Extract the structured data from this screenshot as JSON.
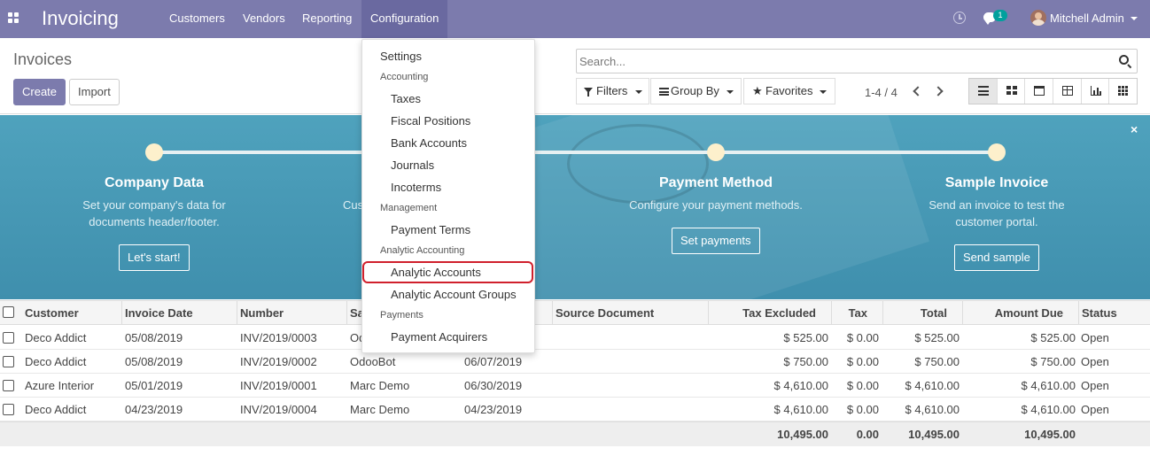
{
  "app": {
    "name": "Invoicing"
  },
  "navbar": {
    "menus": [
      "Customers",
      "Vendors",
      "Reporting",
      "Configuration"
    ],
    "active_menu": "Configuration",
    "message_count": "1",
    "user_name": "Mitchell Admin"
  },
  "control_panel": {
    "title": "Invoices",
    "create_label": "Create",
    "import_label": "Import",
    "search_placeholder": "Search...",
    "filters_label": "Filters",
    "groupby_label": "Group By",
    "favorites_label": "Favorites",
    "pager": "1-4 / 4"
  },
  "onboarding": {
    "close_glyph": "×",
    "steps": [
      {
        "title": "Company Data",
        "desc1": "Set your company's data for",
        "desc2": "documents header/footer.",
        "button": "Let's start!"
      },
      {
        "title": "",
        "desc1": "Cus",
        "desc2": "",
        "button": ""
      },
      {
        "title": "Payment Method",
        "desc1": "Configure your payment methods.",
        "desc2": "",
        "button": "Set payments"
      },
      {
        "title": "Sample Invoice",
        "desc1": "Send an invoice to test the",
        "desc2": "customer portal.",
        "button": "Send sample"
      }
    ]
  },
  "table": {
    "headers": [
      "Customer",
      "Invoice Date",
      "Number",
      "Sa",
      "Source Document",
      "Tax Excluded",
      "Tax",
      "Total",
      "Amount Due",
      "Status"
    ],
    "rows": [
      {
        "customer": "Deco Addict",
        "invoice_date": "05/08/2019",
        "number": "INV/2019/0003",
        "salesperson": "Od",
        "due_date": "",
        "source": "",
        "tax_excluded": "$ 525.00",
        "tax": "$ 0.00",
        "total": "$ 525.00",
        "amount_due": "$ 525.00",
        "status": "Open"
      },
      {
        "customer": "Deco Addict",
        "invoice_date": "05/08/2019",
        "number": "INV/2019/0002",
        "salesperson": "OdooBot",
        "due_date": "06/07/2019",
        "source": "",
        "tax_excluded": "$ 750.00",
        "tax": "$ 0.00",
        "total": "$ 750.00",
        "amount_due": "$ 750.00",
        "status": "Open"
      },
      {
        "customer": "Azure Interior",
        "invoice_date": "05/01/2019",
        "number": "INV/2019/0001",
        "salesperson": "Marc Demo",
        "due_date": "06/30/2019",
        "source": "",
        "tax_excluded": "$ 4,610.00",
        "tax": "$ 0.00",
        "total": "$ 4,610.00",
        "amount_due": "$ 4,610.00",
        "status": "Open"
      },
      {
        "customer": "Deco Addict",
        "invoice_date": "04/23/2019",
        "number": "INV/2019/0004",
        "salesperson": "Marc Demo",
        "due_date": "04/23/2019",
        "source": "",
        "tax_excluded": "$ 4,610.00",
        "tax": "$ 0.00",
        "total": "$ 4,610.00",
        "amount_due": "$ 4,610.00",
        "status": "Open"
      }
    ],
    "totals": {
      "tax_excluded": "10,495.00",
      "tax": "0.00",
      "total": "10,495.00",
      "amount_due": "10,495.00"
    }
  },
  "config_menu": {
    "settings": "Settings",
    "accounting_header": "Accounting",
    "accounting_items": [
      "Taxes",
      "Fiscal Positions",
      "Bank Accounts",
      "Journals",
      "Incoterms"
    ],
    "management_header": "Management",
    "management_items": [
      "Payment Terms"
    ],
    "analytic_header": "Analytic Accounting",
    "analytic_items": [
      "Analytic Accounts",
      "Analytic Account Groups"
    ],
    "payments_header": "Payments",
    "payments_items": [
      "Payment Acquirers"
    ],
    "highlighted_item": "Analytic Accounts"
  },
  "colors": {
    "brand": "#7c7bad",
    "banner": "#4fa2bd",
    "highlight": "#d0202c",
    "badge": "#00a09d"
  }
}
